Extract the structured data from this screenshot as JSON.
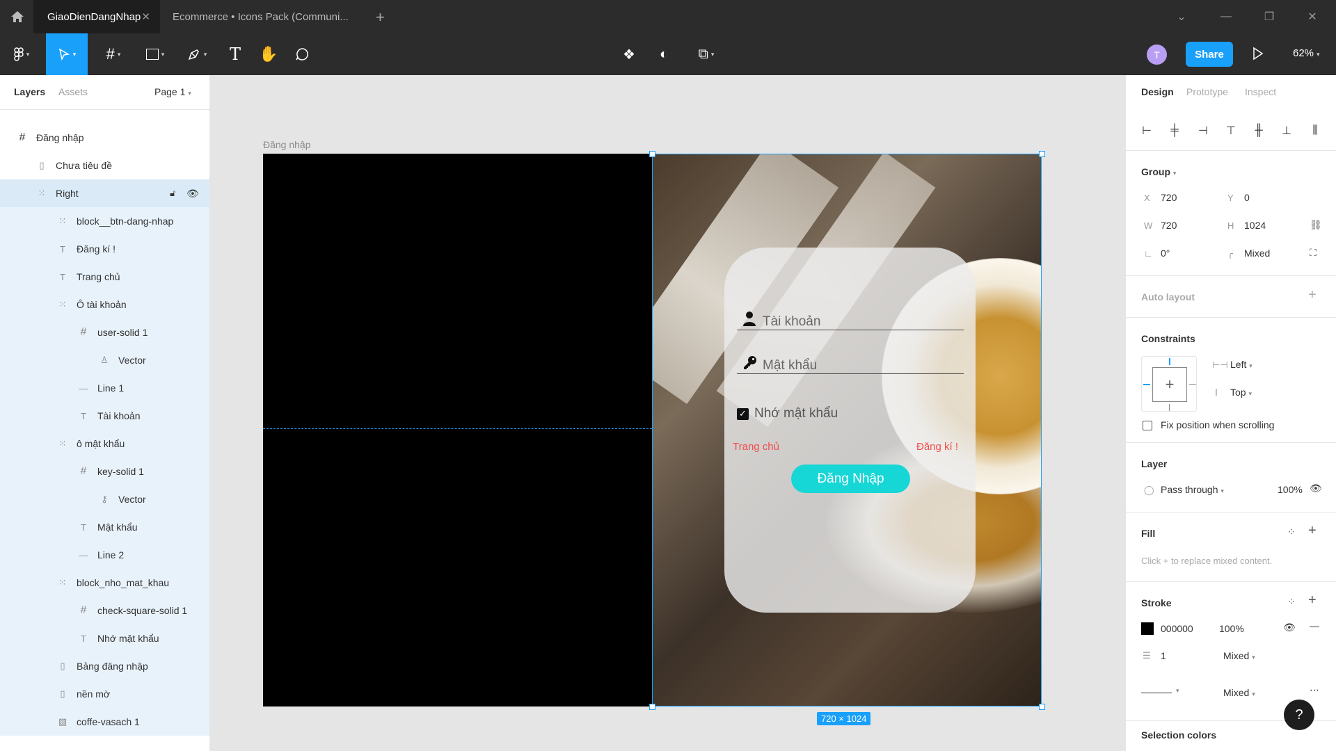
{
  "tabs": {
    "active": "GiaoDienDangNhap",
    "inactive": "Ecommerce • Icons Pack (Communi..."
  },
  "toolbar": {
    "share_label": "Share",
    "zoom": "62%",
    "avatar_initial": "T"
  },
  "left_panel": {
    "tabs": [
      "Layers",
      "Assets"
    ],
    "page": "Page 1",
    "layers": [
      "Đăng nhập",
      "Chưa tiêu đề",
      "Right",
      "block__btn-dang-nhap",
      "Đăng kí !",
      "Trang chủ",
      "Ô tài khoản",
      "user-solid 1",
      "Vector",
      "Line 1",
      "Tài khoản",
      "ô mật khẩu",
      "key-solid 1",
      "Vector",
      "Mật khẩu",
      "Line 2",
      "block_nho_mat_khau",
      "check-square-solid 1",
      "Nhớ mật khẩu",
      "Bảng đăng nhập",
      "nền mờ",
      "coffe-vasach 1"
    ]
  },
  "canvas": {
    "frame_label": "Đăng nhập",
    "username_placeholder": "Tài khoản",
    "password_placeholder": "Mật khẩu",
    "remember": "Nhớ mật khẩu",
    "home_link": "Trang chủ",
    "register_link": "Đăng kí !",
    "login_button": "Đăng Nhập",
    "dimensions": "720 × 1024"
  },
  "right_panel": {
    "tabs": [
      "Design",
      "Prototype",
      "Inspect"
    ],
    "group": {
      "title": "Group",
      "x_label": "X",
      "x": "720",
      "y_label": "Y",
      "y": "0",
      "w_label": "W",
      "w": "720",
      "h_label": "H",
      "h": "1024",
      "rotation": "0°",
      "radius": "Mixed"
    },
    "auto_layout": "Auto layout",
    "constraints": {
      "title": "Constraints",
      "horizontal": "Left",
      "vertical": "Top",
      "fix_position": "Fix position when scrolling"
    },
    "layer": {
      "title": "Layer",
      "blend": "Pass through",
      "opacity": "100%"
    },
    "fill": {
      "title": "Fill",
      "hint": "Click + to replace mixed content."
    },
    "stroke": {
      "title": "Stroke",
      "color": "000000",
      "opacity": "100%",
      "weight": "1",
      "weight_mode": "Mixed",
      "style_mode": "Mixed"
    },
    "selection_colors": "Selection colors"
  },
  "colors": {
    "accent": "#18a0fb",
    "button": "#16d6d6",
    "link": "#f04d4d"
  }
}
